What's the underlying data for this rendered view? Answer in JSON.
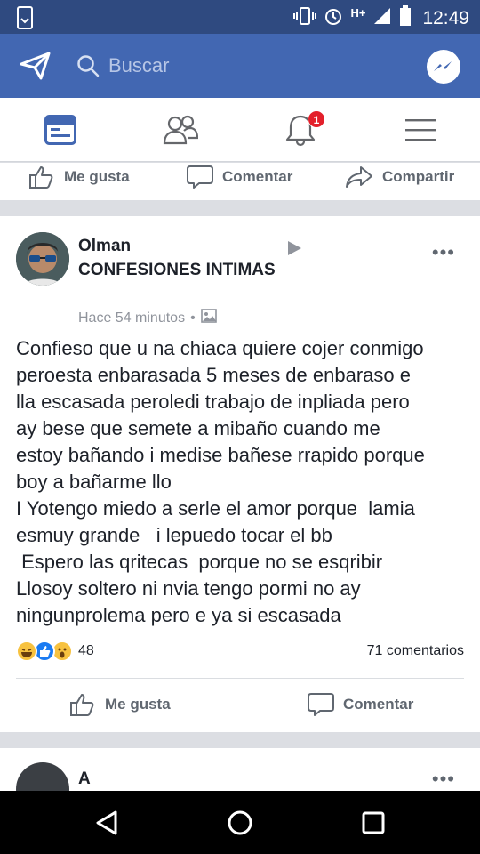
{
  "status_bar": {
    "time": "12:49",
    "network": "H+"
  },
  "header": {
    "search_placeholder": "Buscar"
  },
  "nav": {
    "notifications_badge": "1"
  },
  "prev_post_actions": {
    "like": "Me gusta",
    "comment": "Comentar",
    "share": "Compartir"
  },
  "post": {
    "author": "Olman",
    "group": "CONFESIONES INTIMAS",
    "timestamp": "Hace 54 minutos",
    "body": "Confieso que u na chiaca quiere cojer conmigo\nperoesta enbarasada 5 meses de enbaraso e\nlla escasada peroledi trabajo de inpliada pero\nay bese que semete a mibaño cuando me\nestoy bañando i medise bañese rrapido porque\nboy a bañarme llo\nI Yotengo miedo a serle el amor porque  lamia\nesmuy grande   i lepuedo tocar el bb\n Espero las qritecas  porque no se esqribir\nLlosoy soltero ni nvia tengo pormi no ay\nningunprolema pero e ya si escasada",
    "reaction_count": "48",
    "comments_count": "71 comentarios",
    "like_label": "Me gusta",
    "comment_label": "Comentar"
  },
  "next_post": {
    "author_partial": "A"
  },
  "colors": {
    "fb_blue": "#4267b2",
    "status_blue": "#2f4a80",
    "badge_red": "#e3202b",
    "reaction_yellow": "#f7c240",
    "like_blue": "#1a7bf2"
  }
}
